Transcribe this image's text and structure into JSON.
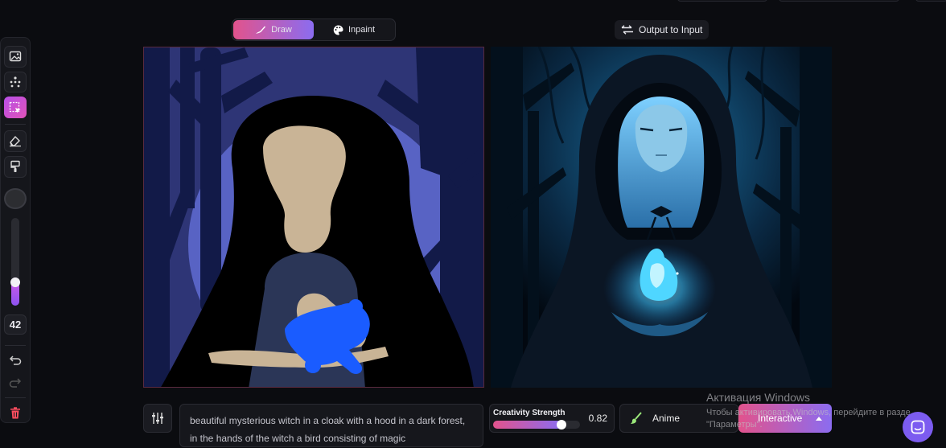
{
  "mode_toggle": {
    "draw_label": "Draw",
    "inpaint_label": "Inpaint",
    "active": "Draw"
  },
  "output_to_input": {
    "label": "Output to Input",
    "icon": "swap-arrows-icon"
  },
  "toolbar": {
    "tools": [
      {
        "name": "image-upload-icon",
        "active": false
      },
      {
        "name": "pose-nodes-icon",
        "active": false
      },
      {
        "name": "selection-cursor-icon",
        "active": true
      },
      {
        "name": "eraser-icon",
        "active": false
      },
      {
        "name": "paint-fill-icon",
        "active": false
      }
    ],
    "brush_color": "#2c2d31",
    "brush_size_fraction": 0.2,
    "brush_size": "42"
  },
  "prompt": {
    "text": "beautiful mysterious witch in a cloak with a hood in a dark forest, in the hands of the witch a bird consisting of magic"
  },
  "creativity": {
    "label": "Creativity Strength",
    "value": "0.82",
    "fraction": 0.82
  },
  "style": {
    "label": "Anime",
    "icon": "brush-icon"
  },
  "generate": {
    "label": "Interactive",
    "icon": "caret-up-icon"
  },
  "watermark": {
    "title": "Активация Windows",
    "line1": "Чтобы активировать Windows, перейдите в разде",
    "line2": "\"Параметры\"."
  },
  "colors": {
    "accent_start": "#e2538c",
    "accent_end": "#8b6cf0",
    "background": "#0b0c10",
    "delete": "#ff4d5e"
  }
}
